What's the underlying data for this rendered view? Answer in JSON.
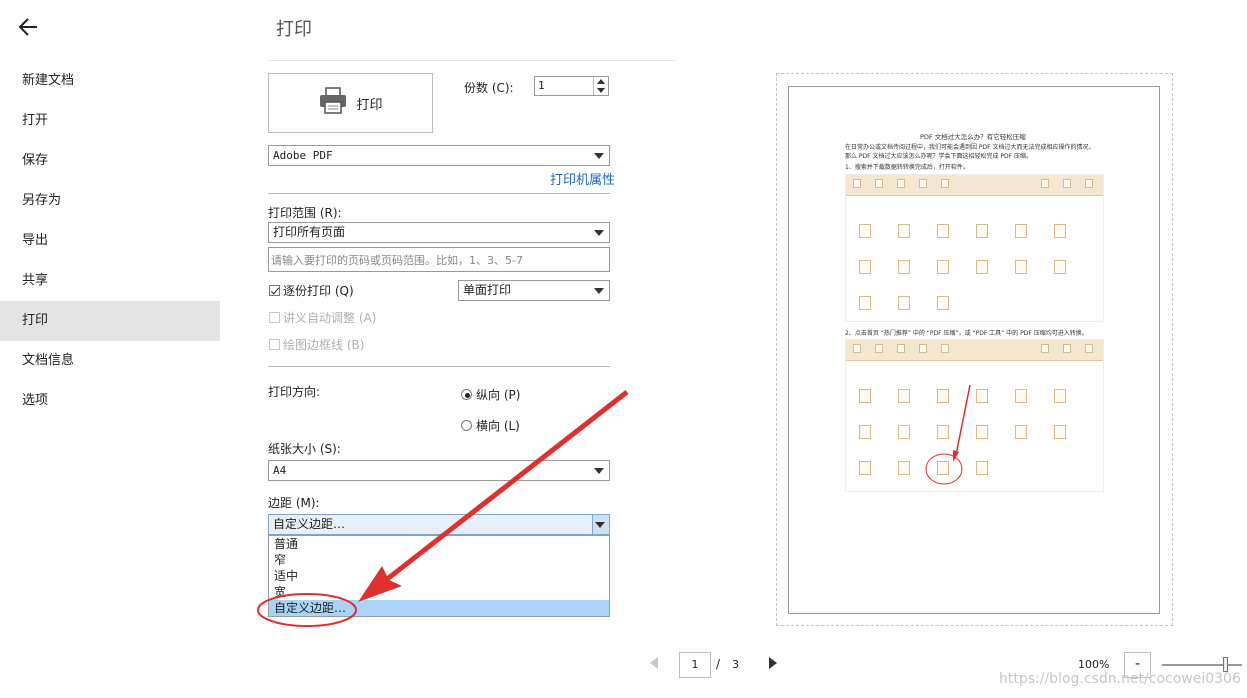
{
  "sidebar": {
    "items": [
      {
        "label": "新建文档"
      },
      {
        "label": "打开"
      },
      {
        "label": "保存"
      },
      {
        "label": "另存为"
      },
      {
        "label": "导出"
      },
      {
        "label": "共享"
      },
      {
        "label": "打印",
        "active": true
      },
      {
        "label": "文档信息"
      },
      {
        "label": "选项"
      }
    ]
  },
  "page_title": "打印",
  "print_panel": {
    "print_button_label": "打印",
    "copies_label": "份数 (C):",
    "copies_value": "1",
    "printer_value": "Adobe PDF",
    "printer_properties_link": "打印机属性",
    "range_label": "打印范围 (R):",
    "range_value": "打印所有页面",
    "range_input_placeholder": "请输入要打印的页码或页码范围。比如，1、3、5-7",
    "collate_label": "逐份打印 (Q)",
    "collate_checked": true,
    "duplex_value": "单面打印",
    "auto_adjust_label": "讲义自动调整 (A)",
    "draw_border_label": "绘图边框线 (B)",
    "orientation_label": "打印方向:",
    "portrait_label": "纵向 (P)",
    "landscape_label": "横向 (L)",
    "paper_size_label": "纸张大小 (S):",
    "paper_size_value": "A4",
    "margins_label": "边距 (M):",
    "margins_value": "自定义边距…",
    "margins_options": [
      "普通",
      "窄",
      "适中",
      "宽",
      "自定义边距…"
    ],
    "margins_selected_index": 4
  },
  "preview": {
    "doc_title": "PDF 文档过大怎么办？有它轻松压缩",
    "para1": "在日常办公或文档传阅过程中，我们可能会遇到因 PDF 文档过大而无法完成相应操作的情况，",
    "para2": "那么 PDF 文档过大应该怎么办呢？学会下面这招轻松完成 PDF 压缩。",
    "step1": "1、搜索并下载数据转转换完成后，打开软件。",
    "step2": "2、点击首页 “热门推荐” 中的 “PDF 压缩”，或 “PDF 工具” 中的 PDF 压缩均可进入转换。"
  },
  "pager": {
    "current_page": "1",
    "separator": "/",
    "total_pages": "3",
    "zoom": "100%",
    "zoom_minus": "-"
  },
  "watermark": "https://blog.csdn.net/cocowei0306",
  "colors": {
    "link": "#1b66c9",
    "annotation_red": "#e0302d",
    "selected_item": "#aad4f7",
    "sidebar_active": "#e4e4e4"
  }
}
